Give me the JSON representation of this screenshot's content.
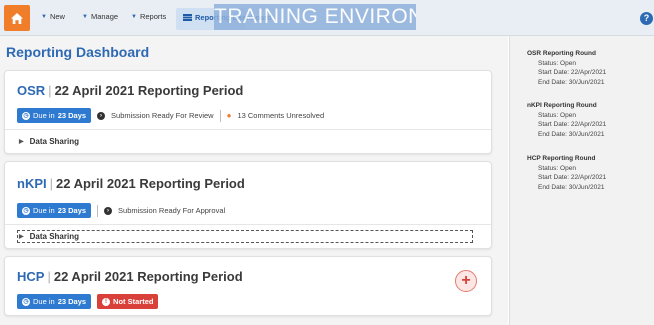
{
  "topbar": {
    "nav": [
      {
        "label": "New"
      },
      {
        "label": "Manage"
      },
      {
        "label": "Reports"
      }
    ],
    "active_tab": {
      "label": "Reporting Dashboard"
    },
    "banner": "TRAINING ENVIRONMENT",
    "help": "?"
  },
  "main": {
    "page_title": "Reporting Dashboard",
    "cards": [
      {
        "code": "OSR",
        "period": "22 April 2021 Reporting Period",
        "due_prefix": "Due in",
        "due_days": "23 Days",
        "status": "Submission Ready For Review",
        "comments": "13 Comments Unresolved",
        "sharing": "Data Sharing"
      },
      {
        "code": "nKPI",
        "period": "22 April 2021 Reporting Period",
        "due_prefix": "Due in",
        "due_days": "23 Days",
        "status": "Submission Ready For Approval",
        "sharing": "Data Sharing"
      },
      {
        "code": "HCP",
        "period": "22 April 2021 Reporting Period",
        "due_prefix": "Due in",
        "due_days": "23 Days",
        "status": "Not Started",
        "add_label": "+"
      }
    ]
  },
  "sidebar": {
    "rounds": [
      {
        "title": "OSR Reporting Round",
        "status": "Status: Open",
        "start": "Start Date: 22/Apr/2021",
        "end": "End Date: 30/Jun/2021"
      },
      {
        "title": "nKPI Reporting Round",
        "status": "Status: Open",
        "start": "Start Date: 22/Apr/2021",
        "end": "End Date: 30/Jun/2021"
      },
      {
        "title": "HCP Reporting Round",
        "status": "Status: Open",
        "start": "Start Date: 22/Apr/2021",
        "end": "End Date: 30/Jun/2021"
      }
    ]
  },
  "colors": {
    "accent": "#2e6ab3",
    "home": "#ef7d29",
    "due_badge": "#2e7ad1",
    "not_started": "#d9403a",
    "banner": "#8fb1dc"
  },
  "icons": [
    "home-icon",
    "caret-down-icon",
    "dashboard-icon",
    "help-icon",
    "clock-icon",
    "arrow-circle-icon",
    "comment-icon",
    "chevron-right-icon",
    "plus-icon",
    "alert-icon"
  ]
}
